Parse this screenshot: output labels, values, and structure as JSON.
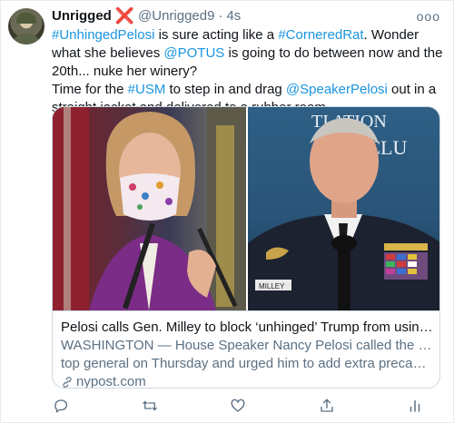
{
  "tweet": {
    "author_name": "Unrigged",
    "name_badge": "❌",
    "handle": "@Unrigged9",
    "separator": "·",
    "time": "4s",
    "more": "ooo",
    "line1": {
      "t1": "#UnhingedPelosi",
      "t2": " is sure acting like a ",
      "t3": "#CorneredRat",
      "t4": ".  Wonder what she believes ",
      "t5": "@POTUS",
      "t6": " is going to do between now and the 20th... nuke her winery?"
    },
    "line2": {
      "t1": "Time for the ",
      "t2": "#USM",
      "t3": " to step in and drag ",
      "t4": "@SpeakerPelosi",
      "t5": " out in a straight jacket and delivered to a rubber room."
    }
  },
  "card": {
    "title": "Pelosi calls Gen. Milley to block ‘unhinged’ Trump from using nuclear…",
    "desc1": "WASHINGTON — House Speaker Nancy Pelosi called the Pentagon’s",
    "desc2": "top general on Thursday and urged him to add extra precautions to …",
    "domain": "nypost.com",
    "right_image_text": {
      "line1": "TI ATION",
      "line2": "H  CLU"
    },
    "name_tag": "MILLEY"
  },
  "icons": {
    "reply": "reply-icon",
    "retweet": "retweet-icon",
    "like": "like-icon",
    "share": "share-icon",
    "analytics": "analytics-icon",
    "link": "link-icon"
  },
  "colors": {
    "link": "#1b95e0",
    "secondary": "#5b7083",
    "badge": "#e0245e"
  }
}
